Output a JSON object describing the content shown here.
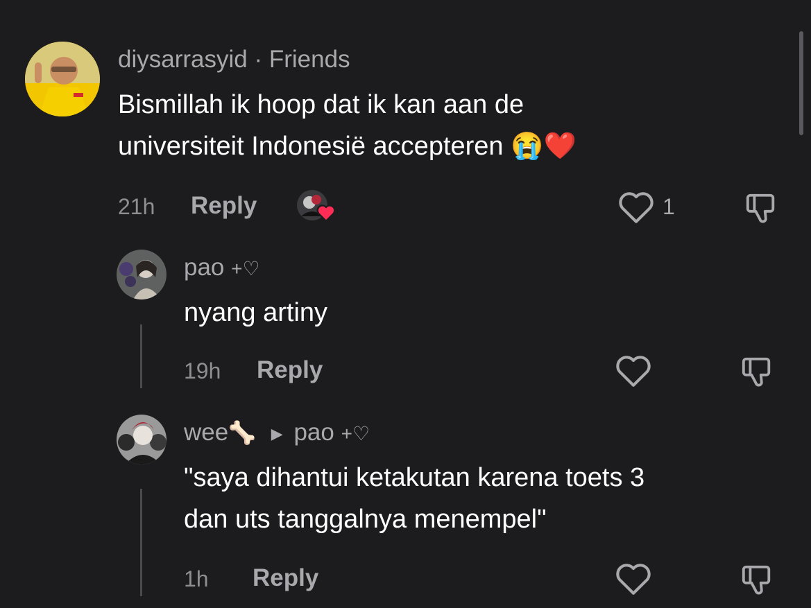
{
  "comments": [
    {
      "author": "diysarrasyid",
      "separator": "·",
      "tag": "Friends",
      "line1": "Bismillah ik hoop dat ik kan aan de",
      "line2": "universiteit Indonesië accepteren",
      "time": "21h",
      "reply": "Reply",
      "likes": "1",
      "emoji_cry": "😭",
      "emoji_heart": "❤️"
    },
    {
      "author": "pao",
      "author_suffix": "+♡",
      "text": "nyang artiny",
      "time": "19h",
      "reply": "Reply"
    },
    {
      "author": "wee",
      "author_emoji": "🦴",
      "reply_to": "pao",
      "reply_to_suffix": "+♡",
      "line1": "\"saya dihantui ketakutan karena toets 3",
      "line2": "dan uts tanggalnya menempel\"",
      "time": "1h",
      "reply": "Reply"
    }
  ],
  "colors": {
    "background": "#1c1c1e",
    "muted_text": "#a8a8ad",
    "like_heart": "#ff2d55"
  }
}
